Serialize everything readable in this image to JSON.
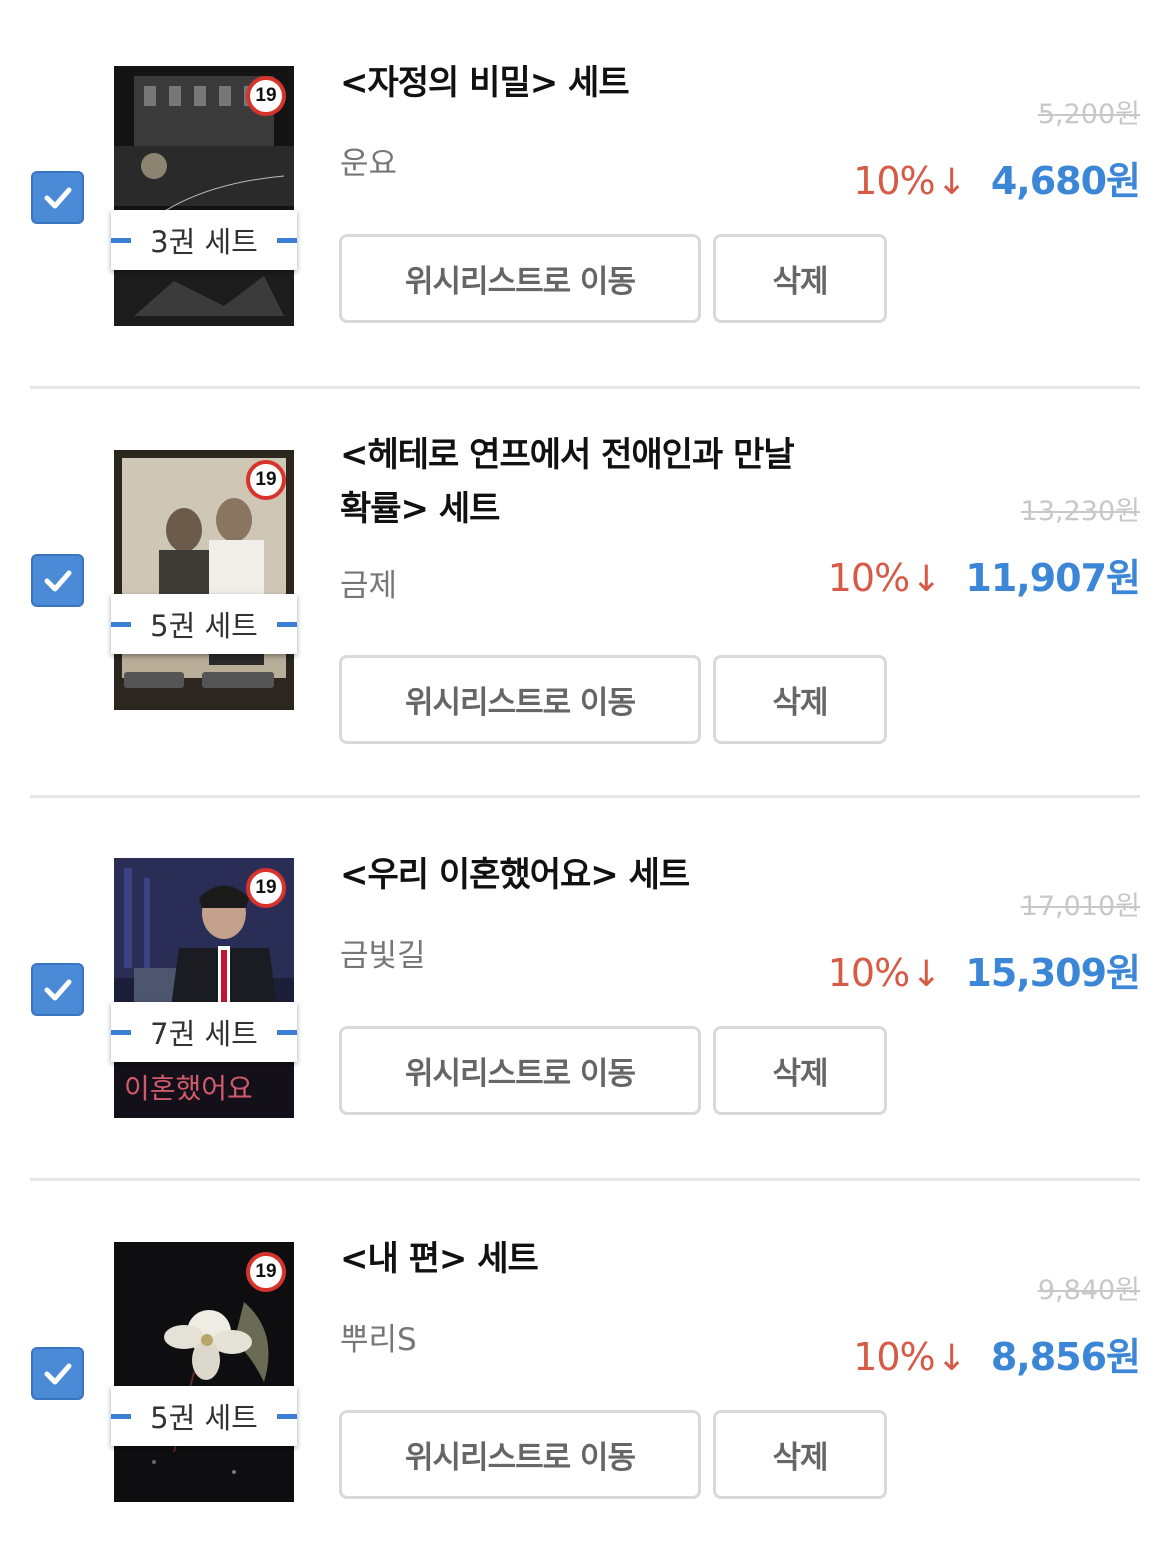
{
  "items": [
    {
      "title": "<자정의 비밀> 세트",
      "author": "운요",
      "set_label": "3권 세트",
      "original_price": "5,200원",
      "discount": "10%",
      "discount_arrow": "↓",
      "price": "4,680원",
      "checked": true,
      "wishlist_label": "위시리스트로 이동",
      "delete_label": "삭제",
      "age_rating": "19"
    },
    {
      "title": "<헤테로 연프에서 전애인과 만날 확률> 세트",
      "author": "금제",
      "set_label": "5권 세트",
      "original_price": "13,230원",
      "discount": "10%",
      "discount_arrow": "↓",
      "price": "11,907원",
      "checked": true,
      "wishlist_label": "위시리스트로 이동",
      "delete_label": "삭제",
      "age_rating": "19"
    },
    {
      "title": "<우리 이혼했어요> 세트",
      "author": "금빛길",
      "set_label": "7권 세트",
      "original_price": "17,010원",
      "discount": "10%",
      "discount_arrow": "↓",
      "price": "15,309원",
      "checked": true,
      "wishlist_label": "위시리스트로 이동",
      "delete_label": "삭제",
      "age_rating": "19"
    },
    {
      "title": "<내 편> 세트",
      "author": "뿌리S",
      "set_label": "5권 세트",
      "original_price": "9,840원",
      "discount": "10%",
      "discount_arrow": "↓",
      "price": "8,856원",
      "checked": true,
      "wishlist_label": "위시리스트로 이동",
      "delete_label": "삭제",
      "age_rating": "19"
    }
  ],
  "colors": {
    "checkbox": "#4a8ad6",
    "price": "#3b86d6",
    "discount": "#d65a46",
    "badge_dash": "#3b7fd2",
    "age_badge_ring": "#d8332a"
  }
}
